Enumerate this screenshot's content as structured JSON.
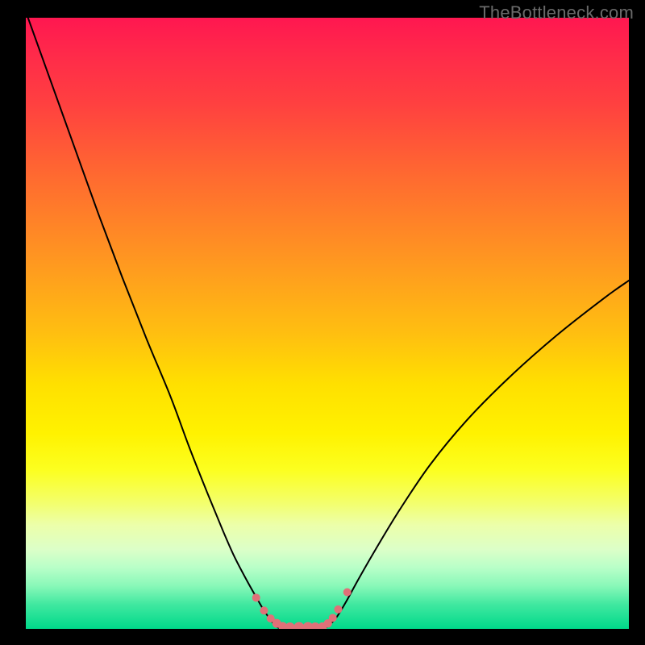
{
  "watermark": "TheBottleneck.com",
  "dot_color": "#e07078",
  "curve_color": "#000000",
  "chart_data": {
    "type": "line",
    "title": "",
    "xlabel": "",
    "ylabel": "",
    "xlim": [
      0,
      100
    ],
    "ylim": [
      0,
      100
    ],
    "series": [
      {
        "name": "left-curve",
        "x": [
          0,
          4,
          8,
          12,
          16,
          20,
          24,
          27,
          30,
          32.5,
          34.5,
          36.5,
          38.2,
          39.5,
          40.5,
          41.3,
          42.0
        ],
        "y": [
          101,
          90,
          79,
          68,
          57.5,
          47.5,
          38,
          30,
          22.5,
          16.5,
          12,
          8.2,
          5.2,
          3.0,
          1.6,
          0.6,
          0.15
        ]
      },
      {
        "name": "floor",
        "x": [
          42.0,
          43.5,
          45.0,
          46.5,
          48.0,
          49.5
        ],
        "y": [
          0.15,
          0.08,
          0.05,
          0.05,
          0.08,
          0.15
        ]
      },
      {
        "name": "right-curve",
        "x": [
          49.5,
          50.4,
          51.6,
          53.2,
          55.2,
          58.0,
          62.0,
          67.0,
          73.0,
          80.0,
          88.0,
          96.0,
          100.0
        ],
        "y": [
          0.15,
          0.7,
          2.0,
          4.6,
          8.2,
          13.0,
          19.5,
          26.8,
          34.0,
          41.0,
          48.0,
          54.2,
          57.0
        ]
      }
    ],
    "dots": {
      "name": "marker-dots",
      "x": [
        38.2,
        39.5,
        40.6,
        41.6,
        42.6,
        43.8,
        45.3,
        46.8,
        48.0,
        49.2,
        50.1,
        50.9,
        51.8,
        53.3
      ],
      "y": [
        5.1,
        3.0,
        1.7,
        0.9,
        0.4,
        0.12,
        0.05,
        0.05,
        0.12,
        0.35,
        0.9,
        1.8,
        3.2,
        6.0
      ],
      "r": [
        5,
        5,
        5,
        5.5,
        5.5,
        6,
        6.5,
        6.5,
        6,
        5.5,
        5.2,
        5,
        5,
        5
      ]
    }
  }
}
